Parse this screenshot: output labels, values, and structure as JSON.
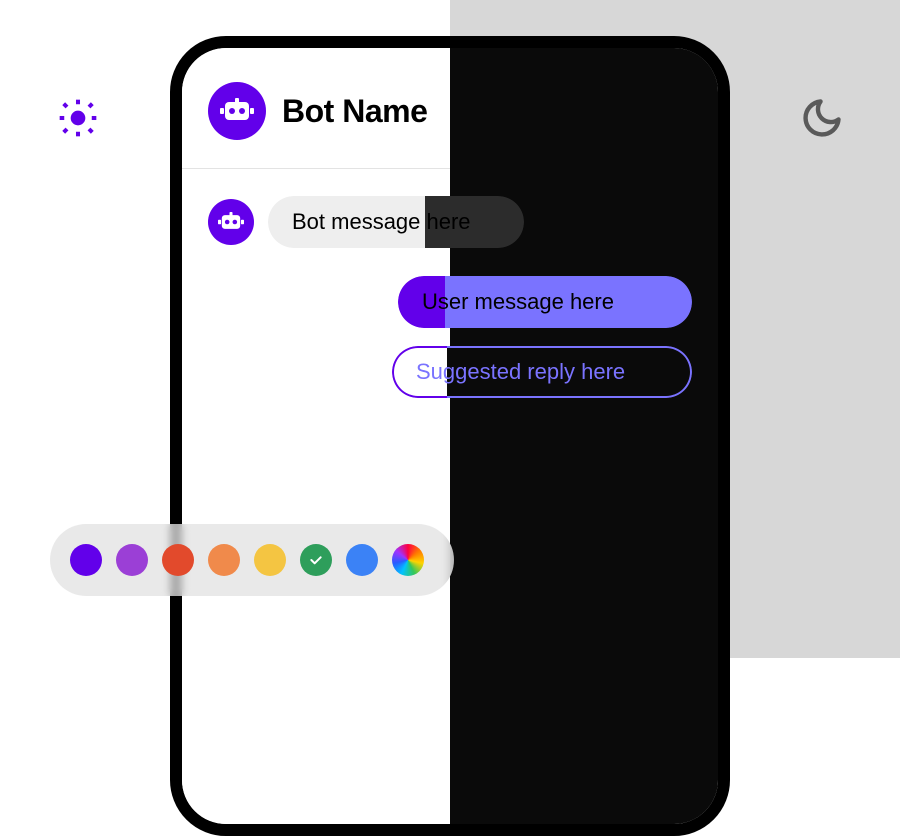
{
  "theme": {
    "light_icon": "sun-icon",
    "dark_icon": "moon-icon"
  },
  "colors": {
    "accent_light": "#6200ea",
    "accent_dark": "#7a73ff"
  },
  "chat": {
    "bot_name": "Bot Name",
    "bot_message": "Bot message here",
    "user_message": "User message here",
    "suggested_reply": "Suggested reply here"
  },
  "palette": {
    "swatches": [
      {
        "color": "#6200ea",
        "selected": false
      },
      {
        "color": "#9b3fd6",
        "selected": false
      },
      {
        "color": "#e24a2c",
        "selected": false
      },
      {
        "color": "#f08a4b",
        "selected": false
      },
      {
        "color": "#f4c542",
        "selected": false
      },
      {
        "color": "#2e9e5b",
        "selected": true
      },
      {
        "color": "#3b82f6",
        "selected": false
      },
      {
        "color": "rainbow",
        "selected": false
      }
    ]
  }
}
